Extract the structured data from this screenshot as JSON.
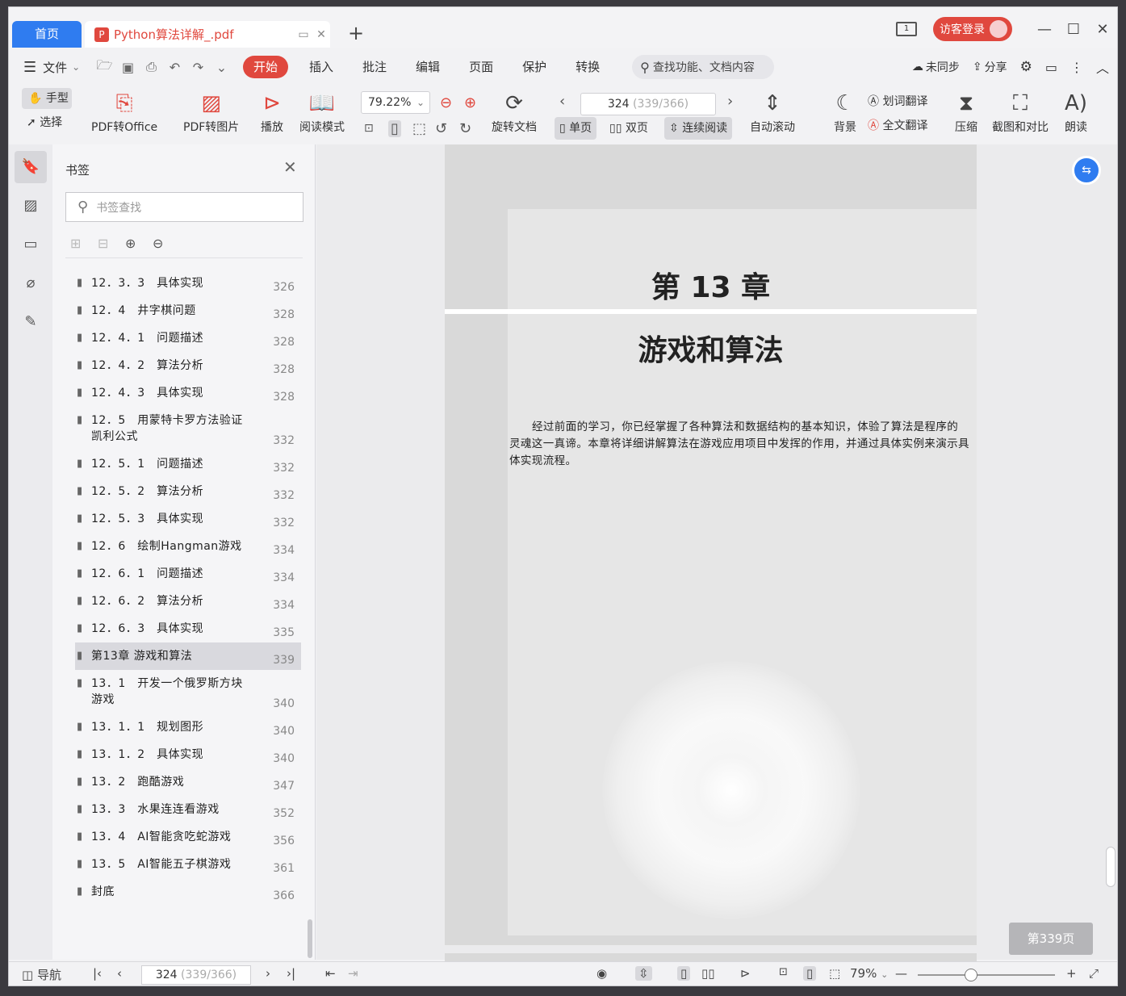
{
  "titlebar": {
    "home_tab": "首页",
    "doc_tab": "Python算法详解_.pdf",
    "add_tab": "+",
    "screen_badge": "1",
    "login": "访客登录"
  },
  "menubar": {
    "file": "文件",
    "tabs": [
      "开始",
      "插入",
      "批注",
      "编辑",
      "页面",
      "保护",
      "转换"
    ],
    "search_placeholder": "查找功能、文档内容",
    "sync": "未同步",
    "share": "分享"
  },
  "toolbar": {
    "hand": "手型",
    "select": "选择",
    "pdf_to_office": "PDF转Office",
    "pdf_to_image": "PDF转图片",
    "play": "播放",
    "read_mode": "阅读模式",
    "zoom": "79.22%",
    "rotate": "旋转文档",
    "page_current": "324",
    "page_total": "(339/366)",
    "single": "单页",
    "double": "双页",
    "continuous": "连续阅读",
    "auto_scroll": "自动滚动",
    "background": "背景",
    "word_translate": "划词翻译",
    "full_translate": "全文翻译",
    "compress": "压缩",
    "screenshot_compare": "截图和对比",
    "read_aloud": "朗读"
  },
  "bookmarks": {
    "title": "书签",
    "search_placeholder": "书签查找",
    "items": [
      {
        "label": "12．3．3　具体实现",
        "page": "326"
      },
      {
        "label": "12．4　井字棋问题",
        "page": "328"
      },
      {
        "label": "12．4．1　问题描述",
        "page": "328"
      },
      {
        "label": "12．4．2　算法分析",
        "page": "328"
      },
      {
        "label": "12．4．3　具体实现",
        "page": "328"
      },
      {
        "label": "12．5　用蒙特卡罗方法验证凯利公式",
        "page": "332"
      },
      {
        "label": "12．5．1　问题描述",
        "page": "332"
      },
      {
        "label": "12．5．2　算法分析",
        "page": "332"
      },
      {
        "label": "12．5．3　具体实现",
        "page": "332"
      },
      {
        "label": "12．6　绘制Hangman游戏",
        "page": "334"
      },
      {
        "label": "12．6．1　问题描述",
        "page": "334"
      },
      {
        "label": "12．6．2　算法分析",
        "page": "334"
      },
      {
        "label": "12．6．3　具体实现",
        "page": "335"
      },
      {
        "label": "第13章 游戏和算法",
        "page": "339"
      },
      {
        "label": "13．1　开发一个俄罗斯方块游戏",
        "page": "340"
      },
      {
        "label": "13．1．1　规划图形",
        "page": "340"
      },
      {
        "label": "13．1．2　具体实现",
        "page": "340"
      },
      {
        "label": "13．2　跑酷游戏",
        "page": "347"
      },
      {
        "label": "13．3　水果连连看游戏",
        "page": "352"
      },
      {
        "label": "13．4　AI智能贪吃蛇游戏",
        "page": "356"
      },
      {
        "label": "13．5　AI智能五子棋游戏",
        "page": "361"
      },
      {
        "label": "封底",
        "page": "366"
      }
    ],
    "selected_index": 13
  },
  "document": {
    "chapter_number": "第 13 章",
    "chapter_title": "游戏和算法",
    "intro": "经过前面的学习，你已经掌握了各种算法和数据结构的基本知识，体验了算法是程序的灵魂这一真谛。本章将详细讲解算法在游戏应用项目中发挥的作用，并通过具体实例来演示具体实现流程。",
    "page_badge": "第339页"
  },
  "statusbar": {
    "nav": "导航",
    "page_current": "324",
    "page_total": "(339/366)",
    "zoom": "79%"
  }
}
